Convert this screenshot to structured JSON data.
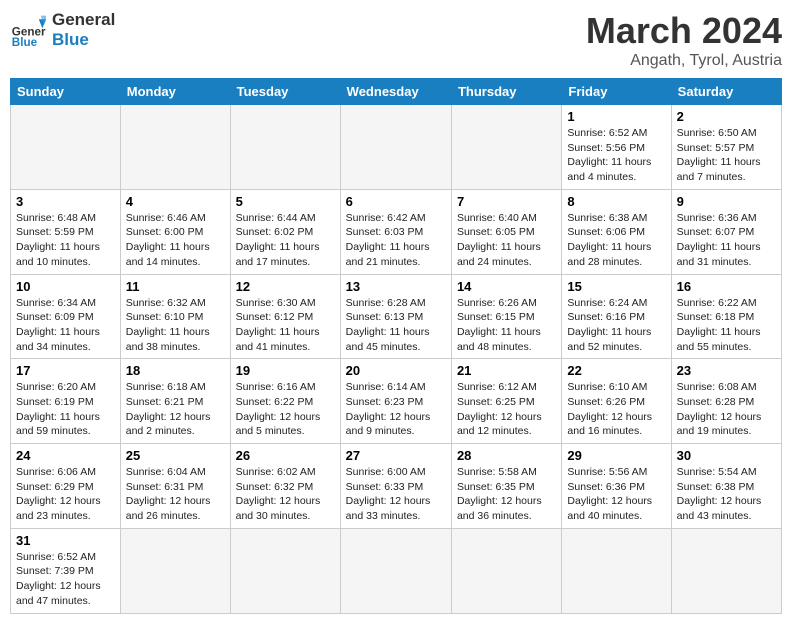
{
  "header": {
    "logo_general": "General",
    "logo_blue": "Blue",
    "month_title": "March 2024",
    "location": "Angath, Tyrol, Austria"
  },
  "weekdays": [
    "Sunday",
    "Monday",
    "Tuesday",
    "Wednesday",
    "Thursday",
    "Friday",
    "Saturday"
  ],
  "weeks": [
    [
      {
        "day": "",
        "info": "",
        "empty": true
      },
      {
        "day": "",
        "info": "",
        "empty": true
      },
      {
        "day": "",
        "info": "",
        "empty": true
      },
      {
        "day": "",
        "info": "",
        "empty": true
      },
      {
        "day": "",
        "info": "",
        "empty": true
      },
      {
        "day": "1",
        "info": "Sunrise: 6:52 AM\nSunset: 5:56 PM\nDaylight: 11 hours and 4 minutes."
      },
      {
        "day": "2",
        "info": "Sunrise: 6:50 AM\nSunset: 5:57 PM\nDaylight: 11 hours and 7 minutes."
      }
    ],
    [
      {
        "day": "3",
        "info": "Sunrise: 6:48 AM\nSunset: 5:59 PM\nDaylight: 11 hours and 10 minutes."
      },
      {
        "day": "4",
        "info": "Sunrise: 6:46 AM\nSunset: 6:00 PM\nDaylight: 11 hours and 14 minutes."
      },
      {
        "day": "5",
        "info": "Sunrise: 6:44 AM\nSunset: 6:02 PM\nDaylight: 11 hours and 17 minutes."
      },
      {
        "day": "6",
        "info": "Sunrise: 6:42 AM\nSunset: 6:03 PM\nDaylight: 11 hours and 21 minutes."
      },
      {
        "day": "7",
        "info": "Sunrise: 6:40 AM\nSunset: 6:05 PM\nDaylight: 11 hours and 24 minutes."
      },
      {
        "day": "8",
        "info": "Sunrise: 6:38 AM\nSunset: 6:06 PM\nDaylight: 11 hours and 28 minutes."
      },
      {
        "day": "9",
        "info": "Sunrise: 6:36 AM\nSunset: 6:07 PM\nDaylight: 11 hours and 31 minutes."
      }
    ],
    [
      {
        "day": "10",
        "info": "Sunrise: 6:34 AM\nSunset: 6:09 PM\nDaylight: 11 hours and 34 minutes."
      },
      {
        "day": "11",
        "info": "Sunrise: 6:32 AM\nSunset: 6:10 PM\nDaylight: 11 hours and 38 minutes."
      },
      {
        "day": "12",
        "info": "Sunrise: 6:30 AM\nSunset: 6:12 PM\nDaylight: 11 hours and 41 minutes."
      },
      {
        "day": "13",
        "info": "Sunrise: 6:28 AM\nSunset: 6:13 PM\nDaylight: 11 hours and 45 minutes."
      },
      {
        "day": "14",
        "info": "Sunrise: 6:26 AM\nSunset: 6:15 PM\nDaylight: 11 hours and 48 minutes."
      },
      {
        "day": "15",
        "info": "Sunrise: 6:24 AM\nSunset: 6:16 PM\nDaylight: 11 hours and 52 minutes."
      },
      {
        "day": "16",
        "info": "Sunrise: 6:22 AM\nSunset: 6:18 PM\nDaylight: 11 hours and 55 minutes."
      }
    ],
    [
      {
        "day": "17",
        "info": "Sunrise: 6:20 AM\nSunset: 6:19 PM\nDaylight: 11 hours and 59 minutes."
      },
      {
        "day": "18",
        "info": "Sunrise: 6:18 AM\nSunset: 6:21 PM\nDaylight: 12 hours and 2 minutes."
      },
      {
        "day": "19",
        "info": "Sunrise: 6:16 AM\nSunset: 6:22 PM\nDaylight: 12 hours and 5 minutes."
      },
      {
        "day": "20",
        "info": "Sunrise: 6:14 AM\nSunset: 6:23 PM\nDaylight: 12 hours and 9 minutes."
      },
      {
        "day": "21",
        "info": "Sunrise: 6:12 AM\nSunset: 6:25 PM\nDaylight: 12 hours and 12 minutes."
      },
      {
        "day": "22",
        "info": "Sunrise: 6:10 AM\nSunset: 6:26 PM\nDaylight: 12 hours and 16 minutes."
      },
      {
        "day": "23",
        "info": "Sunrise: 6:08 AM\nSunset: 6:28 PM\nDaylight: 12 hours and 19 minutes."
      }
    ],
    [
      {
        "day": "24",
        "info": "Sunrise: 6:06 AM\nSunset: 6:29 PM\nDaylight: 12 hours and 23 minutes."
      },
      {
        "day": "25",
        "info": "Sunrise: 6:04 AM\nSunset: 6:31 PM\nDaylight: 12 hours and 26 minutes."
      },
      {
        "day": "26",
        "info": "Sunrise: 6:02 AM\nSunset: 6:32 PM\nDaylight: 12 hours and 30 minutes."
      },
      {
        "day": "27",
        "info": "Sunrise: 6:00 AM\nSunset: 6:33 PM\nDaylight: 12 hours and 33 minutes."
      },
      {
        "day": "28",
        "info": "Sunrise: 5:58 AM\nSunset: 6:35 PM\nDaylight: 12 hours and 36 minutes."
      },
      {
        "day": "29",
        "info": "Sunrise: 5:56 AM\nSunset: 6:36 PM\nDaylight: 12 hours and 40 minutes."
      },
      {
        "day": "30",
        "info": "Sunrise: 5:54 AM\nSunset: 6:38 PM\nDaylight: 12 hours and 43 minutes."
      }
    ],
    [
      {
        "day": "31",
        "info": "Sunrise: 6:52 AM\nSunset: 7:39 PM\nDaylight: 12 hours and 47 minutes."
      },
      {
        "day": "",
        "info": "",
        "empty": true
      },
      {
        "day": "",
        "info": "",
        "empty": true
      },
      {
        "day": "",
        "info": "",
        "empty": true
      },
      {
        "day": "",
        "info": "",
        "empty": true
      },
      {
        "day": "",
        "info": "",
        "empty": true
      },
      {
        "day": "",
        "info": "",
        "empty": true
      }
    ]
  ]
}
